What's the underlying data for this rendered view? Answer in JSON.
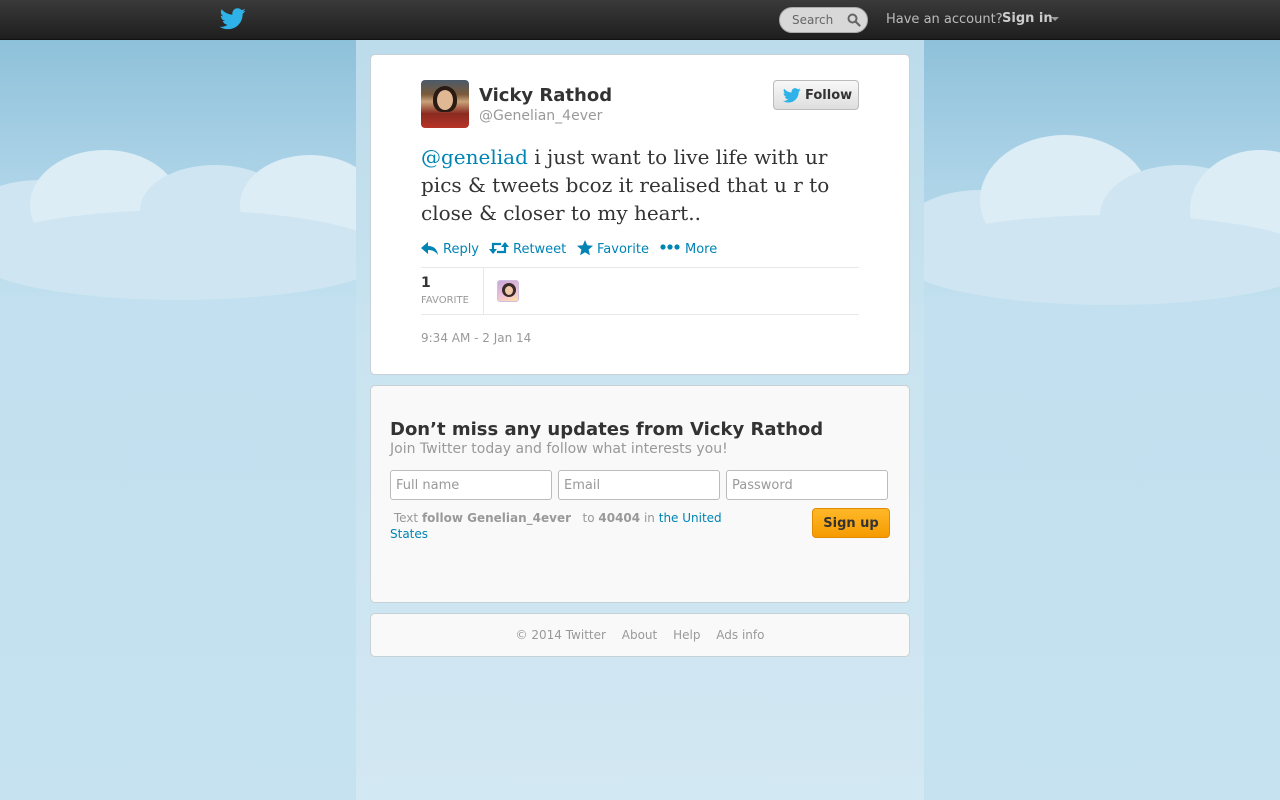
{
  "topbar": {
    "search_placeholder": "Search",
    "have_account": "Have an account?",
    "sign_in": "Sign in"
  },
  "tweet": {
    "display_name": "Vicky Rathod",
    "screen_name": "@Genelian_4ever",
    "follow_label": "Follow",
    "mention": "@geneliad",
    "text": " i just want to live life with ur pics & tweets bcoz it realised that u r to close & closer to my heart..",
    "actions": {
      "reply": "Reply",
      "retweet": "Retweet",
      "favorite": "Favorite",
      "more": "More"
    },
    "favorite_count": "1",
    "favorite_label": "FAVORITE",
    "timestamp": "9:34 AM - 2 Jan 14"
  },
  "signup": {
    "title": "Don’t miss any updates from Vicky Rathod",
    "subtitle": "Join Twitter today and follow what interests you!",
    "fullname_placeholder": "Full name",
    "email_placeholder": "Email",
    "password_placeholder": "Password",
    "sms_text": "Text",
    "sms_command": "follow Genelian_4ever",
    "sms_to": "to",
    "sms_number": "40404",
    "sms_in": "in",
    "sms_country": "the United States",
    "button": "Sign up"
  },
  "footer": {
    "copyright": "© 2014 Twitter",
    "about": "About",
    "help": "Help",
    "ads_info": "Ads info"
  },
  "colors": {
    "link": "#0084b4",
    "signup_button": "#f59b00",
    "twitter_blue": "#2fb2e8"
  }
}
